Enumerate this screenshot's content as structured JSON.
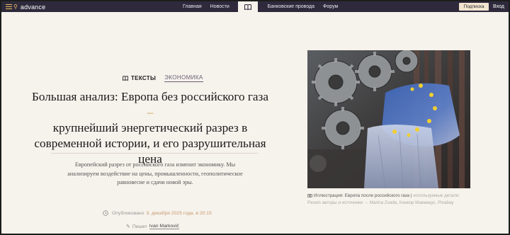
{
  "header": {
    "logo": "advance",
    "nav": [
      "Главная",
      "Новости",
      "Банковские провода",
      "Форум"
    ],
    "subscribe_label": "Подписка",
    "login_label": "Вход"
  },
  "article": {
    "tag_primary": "ТЕКСТЫ",
    "tag_secondary": "ЭКОНОМИКА",
    "headline_lines": [
      "Большая анализ: Европа без российского газа",
      "крупнейший энергетический разрез в",
      "современной истории, и его разрушительная",
      "цена"
    ],
    "headline_dash": "–",
    "lede_lines": [
      "Европейский разрез от российского газа изменит экономику. Мы",
      "анализируем воздействие на цены, промышленности, геополитическое",
      "равновесие и сдачи новой эры."
    ],
    "published_label": "Опубликовано",
    "published_date": "3. декабря 2025 года. в 20:15",
    "author_label": "Пишет",
    "author_name": "Ivan Markovič"
  },
  "image": {
    "caption_main": "Иллюстрация: Европа после российского газа |",
    "caption_muted_1": "используемые детали:",
    "caption_muted_2": "Pexels авторы и источники → Marina Zvada, Конкор Макмакус, Pixabay"
  },
  "colors": {
    "topbar": "#2e2a3c",
    "accent": "#c8a45a",
    "page_bg": "#f6f2ec"
  },
  "icons": [
    "hamburger-icon",
    "search-icon",
    "book-icon",
    "clock-icon",
    "pen-icon",
    "camera-icon"
  ]
}
